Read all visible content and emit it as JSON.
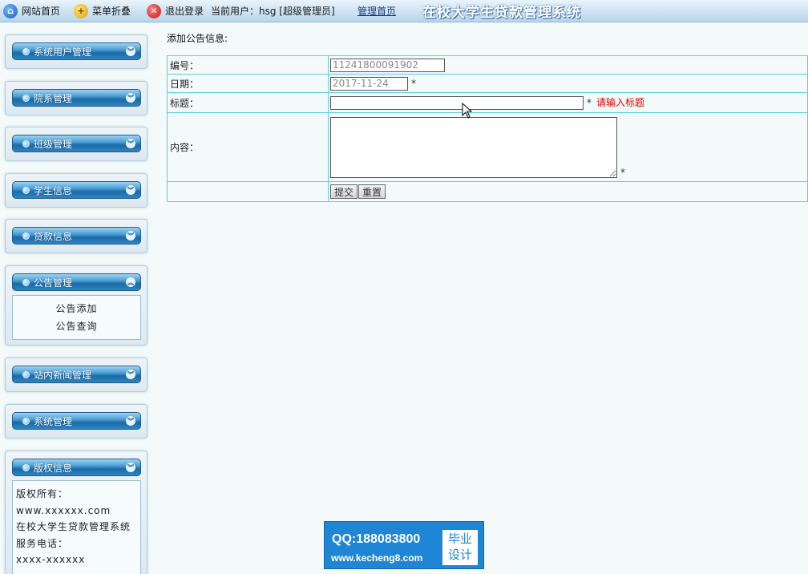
{
  "topbar": {
    "home": "网站首页",
    "fold": "菜单折叠",
    "logout": "退出登录",
    "current_user": "当前用户：hsg [超级管理员]",
    "admin_home": "管理首页",
    "system_title": "在校大学生贷款管理系统"
  },
  "sidebar": {
    "menus": [
      {
        "label": "系统用户管理"
      },
      {
        "label": "院系管理"
      },
      {
        "label": "班级管理"
      },
      {
        "label": "学生信息"
      },
      {
        "label": "贷款信息"
      },
      {
        "label": "公告管理",
        "sub": [
          "公告添加",
          "公告查询"
        ]
      },
      {
        "label": "站内新闻管理"
      },
      {
        "label": "系统管理"
      },
      {
        "label": "版权信息"
      }
    ],
    "copyright": {
      "line1": "版权所有：",
      "line2": "www.xxxxxx.com",
      "line3": "在校大学生贷款管理系统",
      "line4": "服务电话：",
      "line5": "xxxx-xxxxxx"
    }
  },
  "main": {
    "title": "添加公告信息:",
    "form": {
      "id_label": "编号：",
      "id_value": "11241800091902",
      "date_label": "日期：",
      "date_value": "2017-11-24",
      "title_label": "标题：",
      "title_value": "",
      "title_error": "请输入标题",
      "content_label": "内容：",
      "required_mark": "*",
      "submit": "提交",
      "reset": "重置"
    }
  },
  "watermark": {
    "qq": "QQ:188083800",
    "url": "www.kecheng8.com",
    "badge_line1": "毕业",
    "badge_line2": "设计"
  }
}
